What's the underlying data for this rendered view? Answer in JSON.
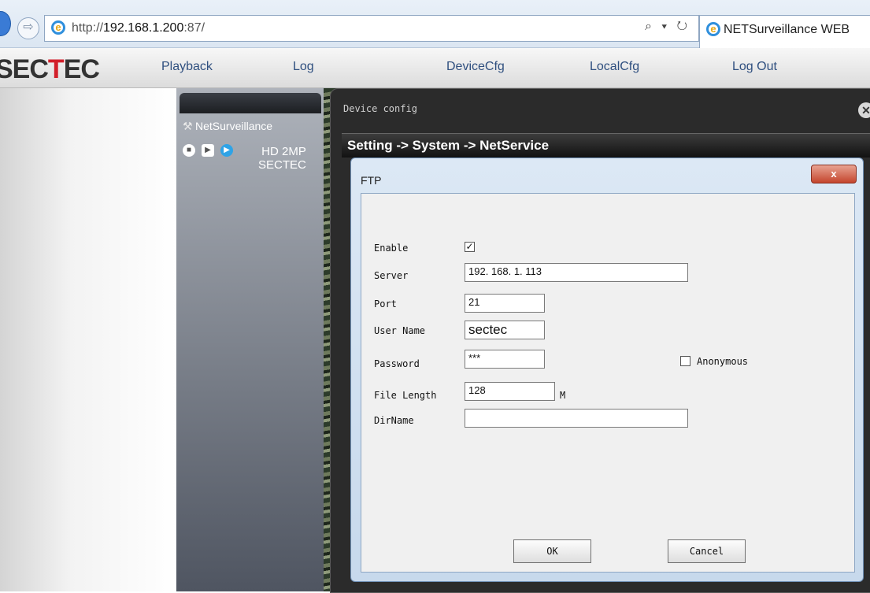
{
  "browser": {
    "url_prefix": "http://",
    "url_host": "192.168.1.200",
    "url_suffix": ":87/",
    "address_icons": "⌕ ▾ ↻",
    "tab_title": "NETSurveillance WEB"
  },
  "app": {
    "brand_part1": "SEC",
    "brand_accent": "T",
    "brand_part2": "EC",
    "nav": [
      "Playback",
      "Log",
      "DeviceCfg",
      "LocalCfg",
      "Log Out"
    ]
  },
  "sidebar": {
    "root_label": "NetSurveillance",
    "device_name_line1": "HD 2MP",
    "device_name_line2": "SECTEC"
  },
  "device_config": {
    "title": "Device config",
    "breadcrumb": "Setting -> System -> NetService"
  },
  "ftp": {
    "title": "FTP",
    "close_label": "x",
    "enable_label": "Enable",
    "enable_checked": true,
    "server_label": "Server",
    "server_value": "192. 168. 1. 113",
    "port_label": "Port",
    "port_value": "21",
    "username_label": "User Name",
    "username_value": "sectec",
    "password_label": "Password",
    "password_value": "***",
    "anonymous_label": "Anonymous",
    "anonymous_checked": false,
    "filelength_label": "File Length",
    "filelength_value": "128",
    "filelength_unit": "M",
    "dirname_label": "DirName",
    "dirname_value": "",
    "ok_label": "OK",
    "cancel_label": "Cancel"
  },
  "colors": {
    "brand_accent": "#d21f2a",
    "nav_text": "#2f4f7f",
    "dialog_close": "#c4452d"
  }
}
